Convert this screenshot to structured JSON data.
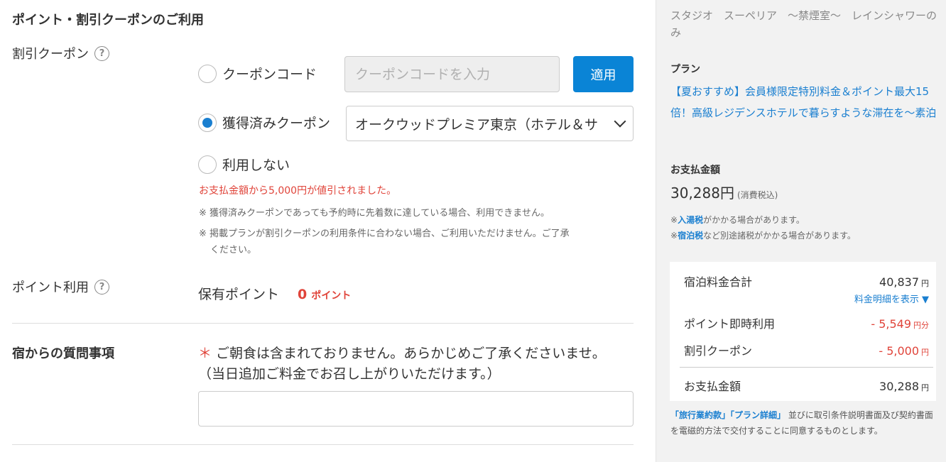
{
  "main": {
    "section_title": "ポイント・割引クーポンのご利用",
    "coupon_label": "割引クーポン",
    "help_glyph": "?",
    "radio_code_label": "クーポンコード",
    "code_placeholder": "クーポンコードを入力",
    "apply_label": "適用",
    "radio_acquired_label": "獲得済みクーポン",
    "selected_coupon": "オークウッドプレミア東京（ホテル＆サ",
    "radio_none_label": "利用しない",
    "selected_radio": "acquired",
    "discount_message": "お支払金額から5,000円が値引されました。",
    "note1": "※ 獲得済みクーポンであっても予約時に先着数に達している場合、利用できません。",
    "note2_line1": "※ 掲載プランが割引クーポンの利用条件に合わない場合、ご利用いただけません。ご了承",
    "note2_line2": "ください。",
    "points_label": "ポイント利用",
    "held_points_label": "保有ポイント",
    "held_points_value": "0",
    "points_unit": "ポイント",
    "question_title": "宿からの質問事項",
    "required_mark": "＊",
    "question_line1": "ご朝食は含まれておりません。あらかじめご了承くださいませ。",
    "question_line2": "（当日追加ご料金でお召し上がりいただけます。）"
  },
  "side": {
    "room_name": "スタジオ　スーペリア　～禁煙室～　レインシャワーのみ",
    "plan_label": "プラン",
    "plan_name": "【夏おすすめ】会員様限定特別料金＆ポイント最大15倍！高級レジデンスホテルで暮らすような滞在を～素泊",
    "pay_label": "お支払金額",
    "pay_amount": "30,288",
    "yen": "円",
    "tax_incl": "(消費税込)",
    "tax_note1_prefix": "※",
    "tax_note1_link": "入湯税",
    "tax_note1_suffix": "がかかる場合があります。",
    "tax_note2_prefix": "※",
    "tax_note2_link": "宿泊税",
    "tax_note2_suffix": "など別途諸税がかかる場合があります。",
    "breakdown": {
      "stay_total_label": "宿泊料金合計",
      "stay_total_value": "40,837",
      "stay_total_unit": "円",
      "detail_link": "料金明細を表示 ▼",
      "points_label": "ポイント即時利用",
      "points_value": "- 5,549",
      "points_unit": "円分",
      "coupon_label": "割引クーポン",
      "coupon_value": "- 5,000",
      "coupon_unit": "円",
      "pay_label": "お支払金額",
      "pay_value": "30,288",
      "pay_unit": "円"
    },
    "terms_link1": "「旅行業約款」",
    "terms_link2": "「プラン詳細」",
    "terms_text": "並びに取引条件説明書面及び契約書面を電磁的方法で交付することに同意するものとします。"
  },
  "colors": {
    "accent_blue": "#0a84d6",
    "link_blue": "#1a7fd0",
    "alert_red": "#e0443a",
    "side_bg": "#f2f2f2"
  }
}
